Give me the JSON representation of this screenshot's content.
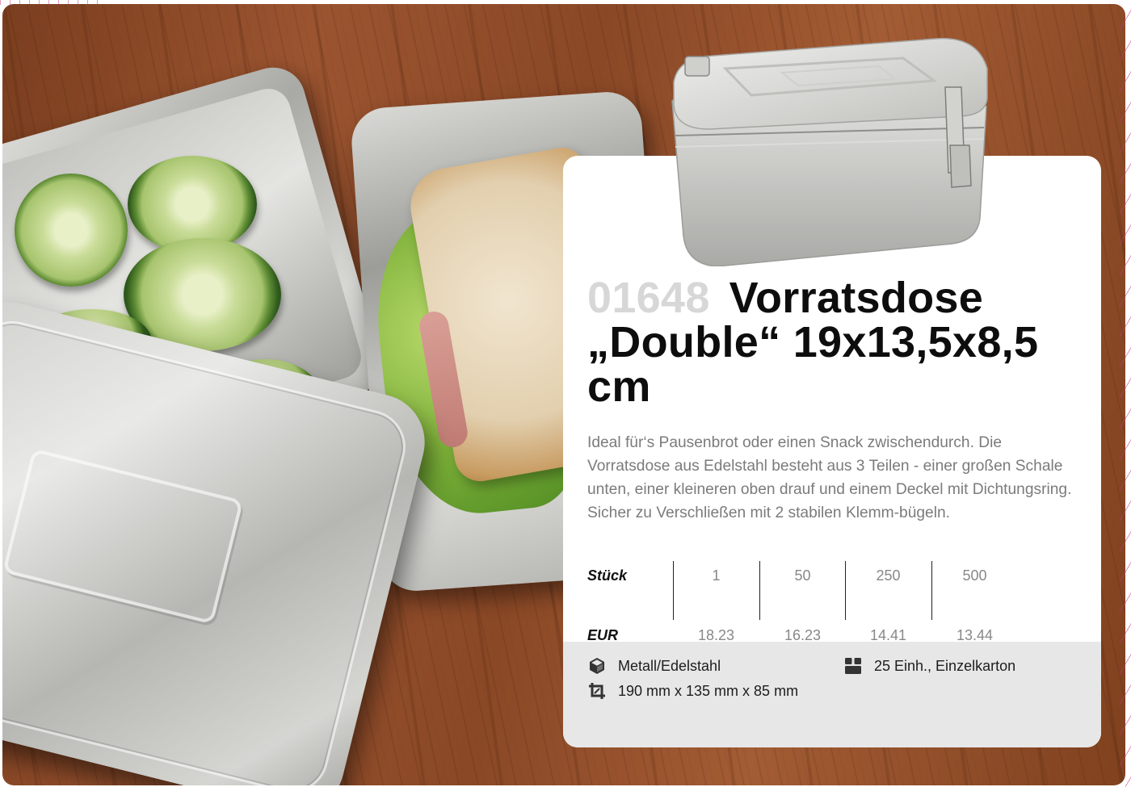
{
  "product": {
    "number": "01648",
    "title": "Vorratsdose „Double“ 19x13,5x8,5 cm",
    "description": "Ideal für‘s Pausenbrot oder einen Snack zwischendurch. Die Vorratsdose aus Edelstahl besteht aus 3 Teilen - einer großen Schale unten, einer kleineren oben drauf und einem Deckel mit Dichtungsring. Sicher zu Verschließen mit 2 stabilen Klemm-bügeln."
  },
  "pricing": {
    "qty_label": "Stück",
    "price_label": "EUR",
    "quantities": [
      "1",
      "50",
      "250",
      "500"
    ],
    "prices": [
      "18.23",
      "16.23",
      "14.41",
      "13.44"
    ]
  },
  "specs": {
    "material": "Metall/Edelstahl",
    "dimensions": "190 mm x 135 mm x 85 mm",
    "packaging": "25 Einh., Einzelkarton"
  },
  "icons": {
    "material": "cube-icon",
    "dimensions": "crop-icon",
    "packaging": "box-icon"
  }
}
